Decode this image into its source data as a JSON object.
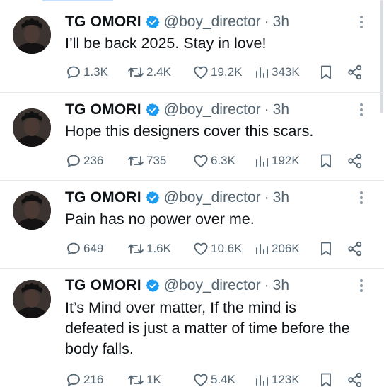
{
  "tweets": [
    {
      "name": "TG OMORI",
      "handle": "@boy_director",
      "sep": "·",
      "time": "3h",
      "text": "I’ll be back 2025. Stay in love!",
      "replies": "1.3K",
      "reposts": "2.4K",
      "likes": "19.2K",
      "views": "343K"
    },
    {
      "name": "TG OMORI",
      "handle": "@boy_director",
      "sep": "·",
      "time": "3h",
      "text": "Hope this designers cover this scars.",
      "replies": "236",
      "reposts": "735",
      "likes": "6.3K",
      "views": "192K"
    },
    {
      "name": "TG OMORI",
      "handle": "@boy_director",
      "sep": "·",
      "time": "3h",
      "text": "Pain has no power over me.",
      "replies": "649",
      "reposts": "1.6K",
      "likes": "10.6K",
      "views": "206K"
    },
    {
      "name": "TG OMORI",
      "handle": "@boy_director",
      "sep": "·",
      "time": "3h",
      "text": "It’s Mind over matter, If the mind is defeated is just a matter of time before the body falls.",
      "replies": "216",
      "reposts": "1K",
      "likes": "5.4K",
      "views": "123K"
    }
  ],
  "colors": {
    "text": "#0f1419",
    "muted": "#536471",
    "verified": "#1d9bf0",
    "divider": "#e6e9ec"
  },
  "icons": {
    "verified": "verified-badge-icon",
    "more": "more-options-icon",
    "reply": "reply-icon",
    "repost": "repost-icon",
    "like": "like-icon",
    "views": "views-icon",
    "bookmark": "bookmark-icon",
    "share": "share-icon"
  }
}
